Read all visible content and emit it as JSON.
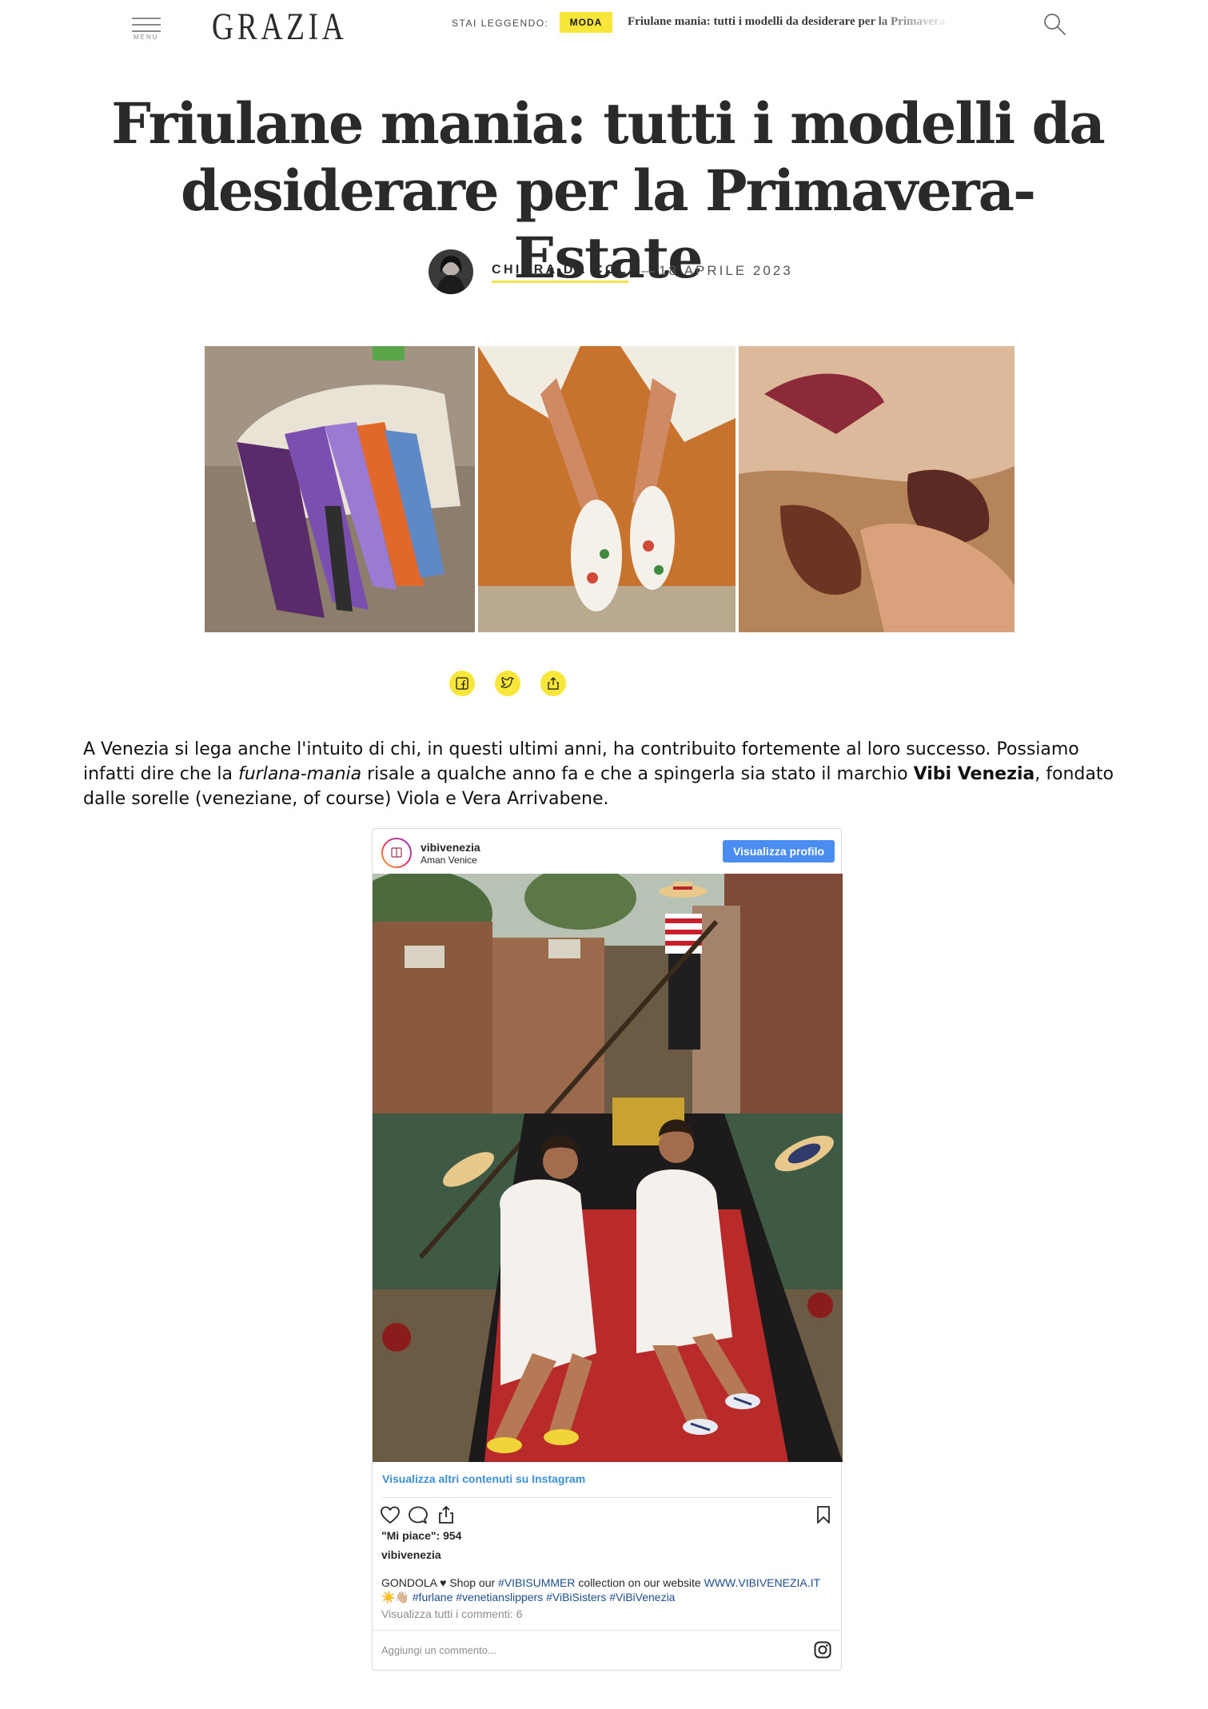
{
  "header": {
    "menu_label": "MENU",
    "logo": "GRAZIA",
    "reading_label": "STAI LEGGENDO:",
    "section_tag": "MODA",
    "reading_title": "Friulane mania: tutti i modelli da desiderare per la Primavera-Estate"
  },
  "article": {
    "title": "Friulane mania: tutti i modelli da desiderare per la Primavera-Estate",
    "author": "CHIARA DA COL",
    "separator": "—",
    "date": "18 APRILE 2023",
    "body": {
      "p1_a": "A Venezia si lega anche l'intuito di chi, in questi ultimi anni, ha contribuito fortemente al loro successo. Possiamo infatti dire che la ",
      "p1_em": "furlana-mania",
      "p1_b": " risale a qualche anno fa e che a spingerla sia stato il marchio ",
      "p1_brand": "Vibi Venezia",
      "p1_c": ", fondato dalle sorelle (veneziane, of course) Viola e Vera Arrivabene."
    }
  },
  "share": {
    "items": [
      "facebook-icon",
      "twitter-icon",
      "share-icon"
    ]
  },
  "instagram": {
    "username": "vibivenezia",
    "location": "Aman Venice",
    "view_profile": "Visualizza profilo",
    "view_more": "Visualizza altri contenuti su Instagram",
    "likes_label": "\"Mi piace\": 954",
    "caption_user": "vibivenezia",
    "caption_a": "GONDOLA ♥ Shop our ",
    "caption_tag1": "#VIBISUMMER",
    "caption_b": " collection on our website ",
    "caption_url": "WWW.VIBIVENEZIA.IT",
    "caption_emoji": "☀️👋🏼",
    "caption_tag2": "#furlane",
    "caption_tag3": "#venetianslippers",
    "caption_tag4": "#ViBiSisters",
    "caption_tag5": "#ViBiVenezia",
    "comments": "Visualizza tutti i commenti: 6",
    "comment_placeholder": "Aggiungi un commento..."
  },
  "colors": {
    "accent_yellow": "#f9e63a",
    "instagram_blue": "#4a8df0",
    "instagram_link": "#3d8fd6",
    "hashtag": "#1f4d8a"
  }
}
